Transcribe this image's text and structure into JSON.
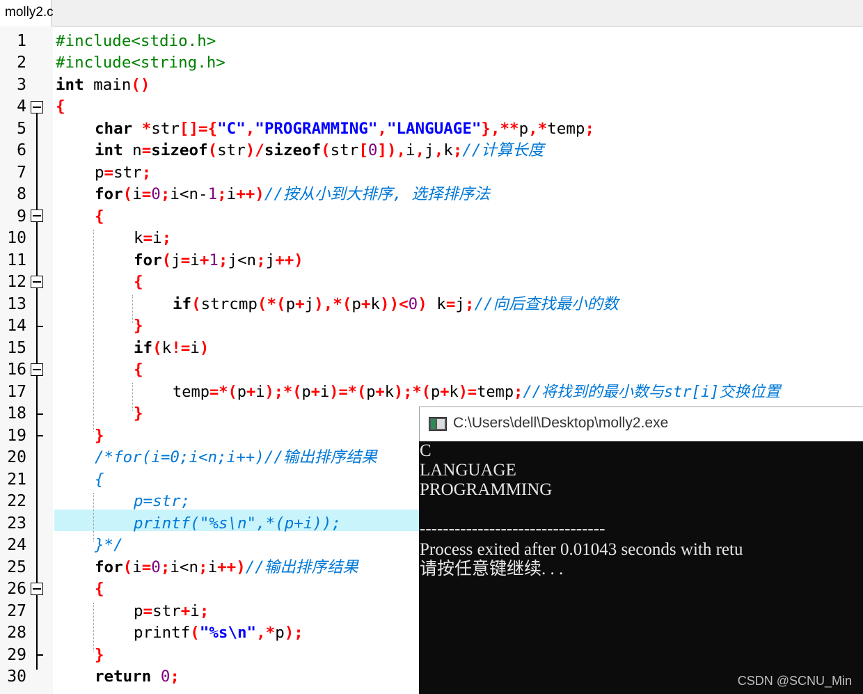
{
  "tab": {
    "label": "molly2.c"
  },
  "editor": {
    "line_numbers": [
      "1",
      "2",
      "3",
      "4",
      "5",
      "6",
      "7",
      "8",
      "9",
      "10",
      "11",
      "12",
      "13",
      "14",
      "15",
      "16",
      "17",
      "18",
      "19",
      "20",
      "21",
      "22",
      "23",
      "24",
      "25",
      "26",
      "27",
      "28",
      "29",
      "30"
    ]
  },
  "code": {
    "l1": "#include<stdio.h>",
    "l2": "#include<string.h>",
    "l3a": "int",
    "l3b": " main",
    "l3c": "()",
    "l4": "{",
    "l5a": "char",
    "l5b": " *",
    "l5c": "str",
    "l5d": "[]={",
    "l5e": "\"C\"",
    "l5f": ",",
    "l5g": "\"PROGRAMMING\"",
    "l5h": ",",
    "l5i": "\"LANGUAGE\"",
    "l5j": "},**",
    "l5k": "p",
    "l5l": ",*",
    "l5m": "temp",
    "l5n": ";",
    "l6a": "int",
    "l6b": " n",
    "l6c": "=",
    "l6d": "sizeof",
    "l6e": "(",
    "l6f": "str",
    "l6g": ")/",
    "l6h": "sizeof",
    "l6i": "(",
    "l6j": "str",
    "l6k": "[",
    "l6l": "0",
    "l6m": "]),",
    "l6n": "i",
    "l6o": ",",
    "l6p": "j",
    "l6q": ",",
    "l6r": "k",
    "l6s": ";",
    "l6t": "//计算长度",
    "l7a": "p",
    "l7b": "=",
    "l7c": "str",
    "l7d": ";",
    "l8a": "for",
    "l8b": "(",
    "l8c": "i",
    "l8d": "=",
    "l8e": "0",
    "l8f": ";",
    "l8g": "i<n-",
    "l8h": "1",
    "l8i": ";",
    "l8j": "i",
    "l8k": "++)",
    "l8l": "//按从小到大排序, 选择排序法",
    "l9": "{",
    "l10a": "k",
    "l10b": "=",
    "l10c": "i",
    "l10d": ";",
    "l11a": "for",
    "l11b": "(",
    "l11c": "j",
    "l11d": "=",
    "l11e": "i",
    "l11f": "+",
    "l11g": "1",
    "l11h": ";",
    "l11i": "j<n",
    "l11j": ";",
    "l11k": "j",
    "l11l": "++)",
    "l12": "{",
    "l13a": "if",
    "l13b": "(",
    "l13c": "strcmp",
    "l13d": "(*(",
    "l13e": "p",
    "l13f": "+",
    "l13g": "j",
    "l13h": "),*(",
    "l13i": "p",
    "l13j": "+",
    "l13k": "k",
    "l13l": "))<",
    "l13m": "0",
    "l13n": ")",
    "l13o": " k",
    "l13p": "=",
    "l13q": "j",
    "l13r": ";",
    "l13s": "//向后查找最小的数",
    "l14": "}",
    "l15a": "if",
    "l15b": "(",
    "l15c": "k",
    "l15d": "!=",
    "l15e": "i",
    "l15f": ")",
    "l16": "{",
    "l17a": "temp",
    "l17b": "=*(",
    "l17c": "p",
    "l17d": "+",
    "l17e": "i",
    "l17f": ");*(",
    "l17g": "p",
    "l17h": "+",
    "l17i": "i",
    "l17j": ")=*(",
    "l17k": "p",
    "l17l": "+",
    "l17m": "k",
    "l17n": ");*(",
    "l17o": "p",
    "l17p": "+",
    "l17q": "k",
    "l17r": ")=",
    "l17s": "temp",
    "l17t": ";",
    "l17u": "//将找到的最小数与str[i]交换位置",
    "l18": "}",
    "l19": "}",
    "l20": "/*for(i=0;i<n;i++)//输出排序结果",
    "l21": "{",
    "l22": "p=str;",
    "l23": "printf(\"%s\\n\",*(p+i));",
    "l24": "}*/",
    "l25a": "for",
    "l25b": "(",
    "l25c": "i",
    "l25d": "=",
    "l25e": "0",
    "l25f": ";",
    "l25g": "i<n",
    "l25h": ";",
    "l25i": "i",
    "l25j": "++)",
    "l25k": "//输出排序结果",
    "l26": "{",
    "l27a": "p",
    "l27b": "=",
    "l27c": "str",
    "l27d": "+",
    "l27e": "i",
    "l27f": ";",
    "l28a": "printf",
    "l28b": "(",
    "l28c": "\"%s\\n\"",
    "l28d": ",*",
    "l28e": "p",
    "l28f": ");",
    "l29": "}",
    "l30a": "return",
    "l30b": " ",
    "l30c": "0",
    "l30d": ";"
  },
  "console": {
    "title": "C:\\Users\\dell\\Desktop\\molly2.exe",
    "output_lines": [
      "C",
      "LANGUAGE",
      "PROGRAMMING",
      "",
      "--------------------------------",
      "Process exited after 0.01043 seconds with retu",
      "请按任意键继续. . ."
    ]
  },
  "watermark": "CSDN @SCNU_Min",
  "colors": {
    "keyword": "#000000",
    "preprocessor": "#008000",
    "string": "#0000ff",
    "number": "#7f007f",
    "operator": "#ff0000",
    "comment": "#0078d7",
    "highlight_line": "#c9f4fb",
    "console_bg": "#0c0c0c"
  }
}
